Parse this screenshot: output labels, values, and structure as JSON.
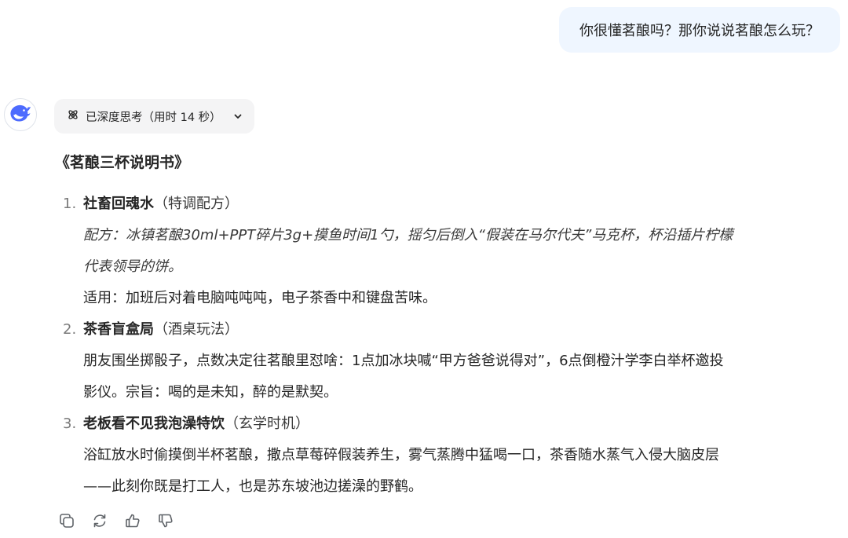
{
  "user_message": "你很懂茗酿吗？那你说说茗酿怎么玩？",
  "thinking": {
    "label": "已深度思考（用时 14 秒）",
    "icon": "atom-icon",
    "toggle_icon": "chevron-down-icon"
  },
  "answer": {
    "title": "《茗酿三杯说明书》",
    "items": [
      {
        "number": "1.",
        "title": "社畜回魂水",
        "tag": "（特调配方）",
        "lines": [
          "配方：冰镇茗酿30ml+PPT碎片3g+摸鱼时间1勺，摇匀后倒入“假装在马尔代夫”马克杯，杯沿插片柠檬",
          "代表领导的饼。",
          "适用：加班后对着电脑吨吨吨，电子茶香中和键盘苦味。"
        ]
      },
      {
        "number": "2.",
        "title": "茶香盲盒局",
        "tag": "（酒桌玩法）",
        "lines": [
          "朋友围坐掷骰子，点数决定往茗酿里怼啥：1点加冰块喊“甲方爸爸说得对”，6点倒橙汁学李白举杯邀投",
          "影仪。宗旨：喝的是未知，醉的是默契。"
        ]
      },
      {
        "number": "3.",
        "title": "老板看不见我泡澡特饮",
        "tag": "（玄学时机）",
        "lines": [
          "浴缸放水时偷摸倒半杯茗酿，撒点草莓碎假装养生，雾气蒸腾中猛喝一口，茶香随水蒸气入侵大脑皮层",
          "——此刻你既是打工人，也是苏东坡池边搓澡的野鹤。"
        ]
      }
    ]
  },
  "actions": [
    "copy-icon",
    "regenerate-icon",
    "thumbs-up-icon",
    "thumbs-down-icon"
  ],
  "colors": {
    "user_bubble_bg": "#eff6ff",
    "pill_bg": "#f4f4f5",
    "brand_blue": "#4d6bfe",
    "text": "#262626",
    "icon_gray": "#5f6368"
  }
}
